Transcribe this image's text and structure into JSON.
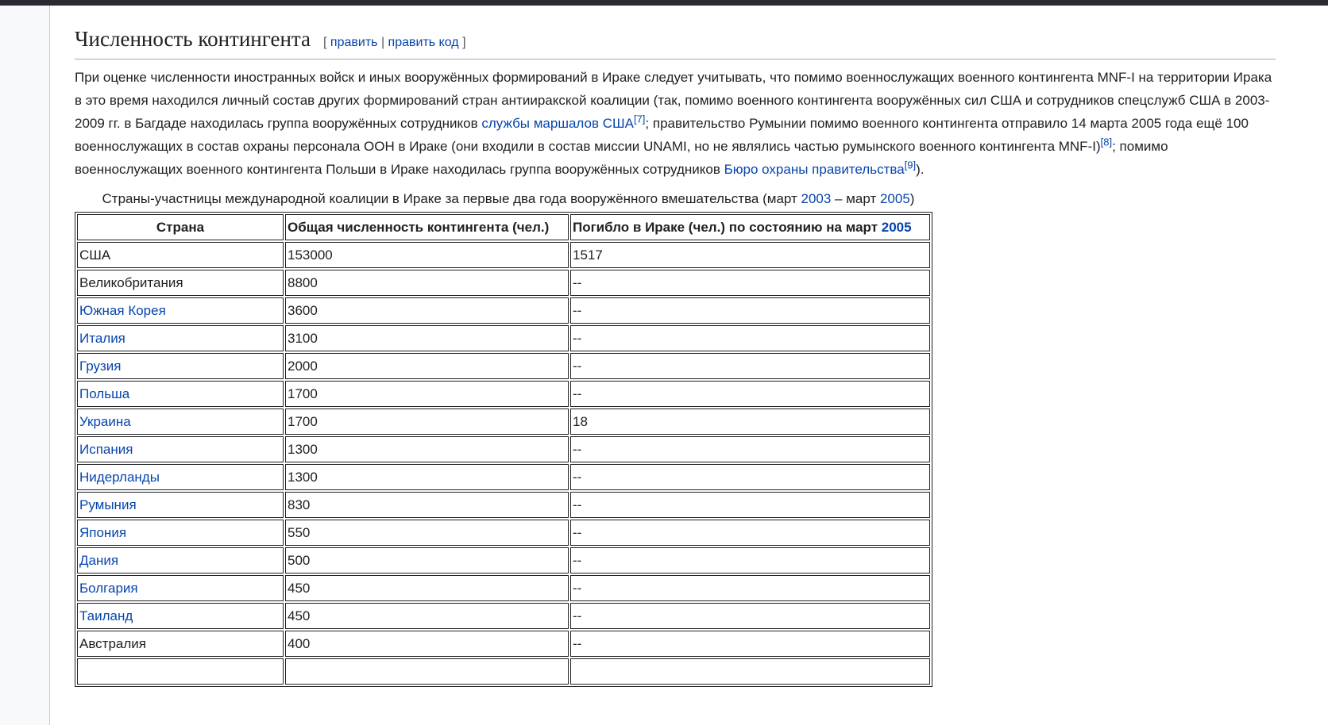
{
  "section": {
    "title": "Численность контингента",
    "edit_open": "[",
    "edit_label": "править",
    "edit_sep": "|",
    "edit_code_label": "править код",
    "edit_close": "]"
  },
  "paragraph": {
    "t1": "При оценке численности иностранных войск и иных вооружённых формирований в Ираке следует учитывать, что помимо военнослужащих военного контингента MNF-I на территории Ирака в это время находился личный состав других формирований стран антииракской коалиции (так, помимо военного контингента вооружённых сил США и сотрудников спецслужб США в 2003-2009 гг. в Багдаде находилась группа вооружённых сотрудников ",
    "link1": "службы маршалов США",
    "ref1": "[7]",
    "t2": "; правительство Румынии помимо военного контингента отправило 14 марта 2005 года ещё 100 военнослужащих в состав охраны персонала ООН в Ираке (они входили в состав миссии UNAMI, но не являлись частью румынского военного контингента MNF-I)",
    "ref2": "[8]",
    "t3": "; помимо военнослужащих военного контингента Польши в Ираке находилась группа вооружённых сотрудников ",
    "link2": "Бюро охраны правительства",
    "ref3": "[9]",
    "t4": ")."
  },
  "caption": {
    "t1": "Страны-участницы международной коалиции в Ираке за первые два года вооружённого вмешательства (март ",
    "link1": "2003",
    "t2": " – март ",
    "link2": "2005",
    "t3": ")"
  },
  "table": {
    "headers": [
      "Страна",
      "Общая численность контингента (чел.)",
      "Погибло в Ираке (чел.) по состоянию на март "
    ],
    "header_link": "2005",
    "rows": [
      {
        "country": "США",
        "link": false,
        "total": "153000",
        "killed": "1517"
      },
      {
        "country": "Великобритания",
        "link": false,
        "total": "8800",
        "killed": "--"
      },
      {
        "country": "Южная Корея",
        "link": true,
        "total": "3600",
        "killed": "--"
      },
      {
        "country": "Италия",
        "link": true,
        "total": "3100",
        "killed": "--"
      },
      {
        "country": "Грузия",
        "link": true,
        "total": "2000",
        "killed": "--"
      },
      {
        "country": "Польша",
        "link": true,
        "total": "1700",
        "killed": "--"
      },
      {
        "country": "Украина",
        "link": true,
        "total": "1700",
        "killed": "18"
      },
      {
        "country": "Испания",
        "link": true,
        "total": "1300",
        "killed": "--"
      },
      {
        "country": "Нидерланды",
        "link": true,
        "total": "1300",
        "killed": "--"
      },
      {
        "country": "Румыния",
        "link": true,
        "total": "830",
        "killed": "--"
      },
      {
        "country": "Япония",
        "link": true,
        "total": "550",
        "killed": "--"
      },
      {
        "country": "Дания",
        "link": true,
        "total": "500",
        "killed": "--"
      },
      {
        "country": "Болгария",
        "link": true,
        "total": "450",
        "killed": "--"
      },
      {
        "country": "Таиланд",
        "link": true,
        "total": "450",
        "killed": "--"
      },
      {
        "country": "Австралия",
        "link": false,
        "total": "400",
        "killed": "--"
      },
      {
        "country": "",
        "link": false,
        "total": "",
        "killed": ""
      }
    ]
  }
}
